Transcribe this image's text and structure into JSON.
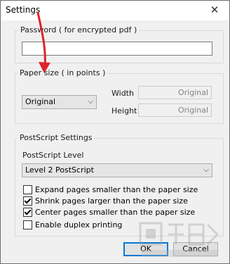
{
  "window": {
    "title": "Settings",
    "close_glyph": "✕"
  },
  "password_group": {
    "legend": "Password ( for encrypted pdf )",
    "value": ""
  },
  "paper_group": {
    "legend": "Paper size ( in points )",
    "size_select": "Original",
    "width_label": "Width",
    "width_value": "Original",
    "height_label": "Height",
    "height_value": "Original"
  },
  "postscript_group": {
    "legend": "PostScript Settings",
    "level_label": "PostScript Level",
    "level_select": "Level 2 PostScript",
    "options": [
      {
        "label": "Expand pages smaller than the paper size",
        "checked": false
      },
      {
        "label": "Shrink pages larger than the paper size",
        "checked": true
      },
      {
        "label": "Center pages smaller than the paper size",
        "checked": true
      },
      {
        "label": "Enable duplex printing",
        "checked": false
      }
    ]
  },
  "buttons": {
    "ok": "OK",
    "cancel": "Cancel"
  },
  "icons": {
    "close": "close-icon",
    "dropdown": "chevron-down-icon",
    "annotation": "red-arrow-annotation",
    "watermark": "site-watermark-logo"
  },
  "colors": {
    "accent": "#0078d7",
    "annotation_arrow": "#e0232a",
    "dialog_bg": "#f0f0f0"
  }
}
